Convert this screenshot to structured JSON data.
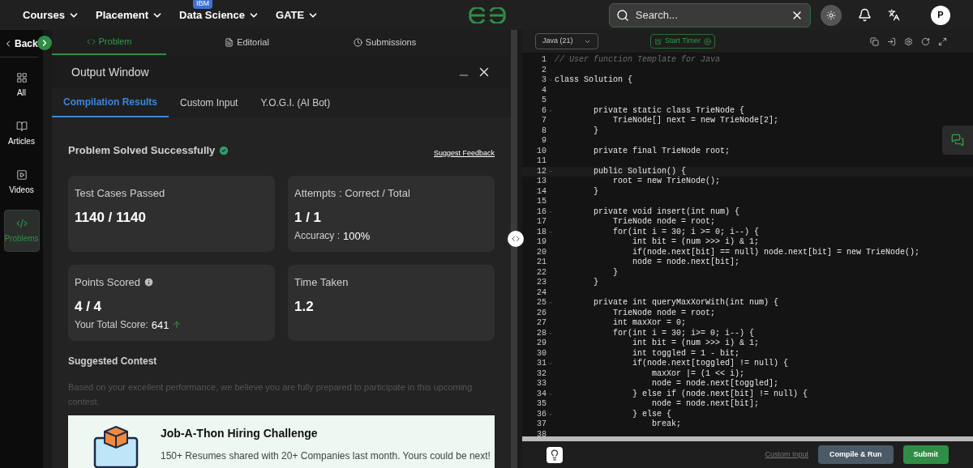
{
  "nav": {
    "menus": [
      {
        "label": "Courses"
      },
      {
        "label": "Placement"
      },
      {
        "label": "Data Science",
        "badge": "IBM"
      },
      {
        "label": "GATE"
      }
    ],
    "search": {
      "placeholder": "Search..."
    },
    "avatar": "P"
  },
  "back": "Back",
  "sidebar": [
    {
      "label": "All",
      "selected": false
    },
    {
      "label": "Articles",
      "selected": false
    },
    {
      "label": "Videos",
      "selected": false
    },
    {
      "label": "Problems",
      "selected": true
    }
  ],
  "problem_tabs": [
    {
      "label": "Problem",
      "selected": true
    },
    {
      "label": "Editorial",
      "selected": false
    },
    {
      "label": "Submissions",
      "selected": false
    }
  ],
  "output": {
    "title": "Output Window",
    "tabs": [
      {
        "label": "Compilation Results",
        "selected": true
      },
      {
        "label": "Custom Input",
        "selected": false
      },
      {
        "label": "Y.O.G.I. (AI Bot)",
        "selected": false
      }
    ],
    "status": "Problem Solved Successfully",
    "feedback": "Suggest Feedback",
    "cards": [
      {
        "title": "Test Cases Passed",
        "value": "1140 / 1140"
      },
      {
        "title": "Attempts : Correct / Total",
        "value": "1 / 1",
        "sub_label": "Accuracy :",
        "sub_value": "100%"
      },
      {
        "title": "Points Scored",
        "value": "4 / 4",
        "info": true,
        "sub_label": "Your Total Score:",
        "sub_value": "641",
        "trend_up": true
      },
      {
        "title": "Time Taken",
        "value": "1.2"
      }
    ],
    "contest_heading": "Suggested Contest",
    "contest_text": "Based on your excellent performance, we believe you are fully prepared to participate in this upcoming contest.",
    "contest": {
      "title": "Job-A-Thon Hiring Challenge",
      "text": "150+ Resumes shared with 20+ Companies last month. Yours could be next!"
    }
  },
  "editor": {
    "language": "Java (21)",
    "timer": "Start Timer",
    "lines": [
      {
        "n": "1",
        "code": "// User function Template for Java",
        "kind": "comment"
      },
      {
        "n": "2"
      },
      {
        "n": "3",
        "code": "class Solution {",
        "fold": true
      },
      {
        "n": "4"
      },
      {
        "n": "5"
      },
      {
        "n": "6",
        "code": "        private static class TrieNode {",
        "fold": true
      },
      {
        "n": "7",
        "code": "            TrieNode[] next = new TrieNode[2];"
      },
      {
        "n": "8",
        "code": "        }"
      },
      {
        "n": "9"
      },
      {
        "n": "10",
        "code": "        private final TrieNode root;"
      },
      {
        "n": "11"
      },
      {
        "n": "12",
        "code": "        public Solution() {",
        "fold": true,
        "current": true
      },
      {
        "n": "13",
        "code": "            root = new TrieNode();"
      },
      {
        "n": "14",
        "code": "        }"
      },
      {
        "n": "15"
      },
      {
        "n": "16",
        "code": "        private void insert(int num) {",
        "fold": true
      },
      {
        "n": "17",
        "code": "            TrieNode node = root;"
      },
      {
        "n": "18",
        "code": "            for(int i = 30; i >= 0; i--) {",
        "fold": true
      },
      {
        "n": "19",
        "code": "                int bit = (num >>> i) & 1;"
      },
      {
        "n": "20",
        "code": "                if(node.next[bit] == null) node.next[bit] = new TrieNode();"
      },
      {
        "n": "21",
        "code": "                node = node.next[bit];"
      },
      {
        "n": "22",
        "code": "            }"
      },
      {
        "n": "23",
        "code": "        }"
      },
      {
        "n": "24"
      },
      {
        "n": "25",
        "code": "        private int queryMaxXorWith(int num) {",
        "fold": true
      },
      {
        "n": "26",
        "code": "            TrieNode node = root;"
      },
      {
        "n": "27",
        "code": "            int maxXor = 0;"
      },
      {
        "n": "28",
        "code": "            for(int i = 30; i>= 0; i--) {",
        "fold": true
      },
      {
        "n": "29",
        "code": "                int bit = (num >>> i) & 1;"
      },
      {
        "n": "30",
        "code": "                int toggled = 1 - bit;"
      },
      {
        "n": "31",
        "code": "                if(node.next[toggled] != null) {",
        "fold": true
      },
      {
        "n": "32",
        "code": "                    maxXor |= (1 << i);"
      },
      {
        "n": "33",
        "code": "                    node = node.next[toggled];"
      },
      {
        "n": "34",
        "code": "                } else if (node.next[bit] != null) {",
        "fold": true
      },
      {
        "n": "35",
        "code": "                    node = node.next[bit];"
      },
      {
        "n": "36",
        "code": "                } else {",
        "fold": true
      },
      {
        "n": "37",
        "code": "                    break;"
      },
      {
        "n": "38"
      }
    ],
    "custom_input": "Custom Input",
    "compile": "Compile & Run",
    "submit": "Submit"
  }
}
